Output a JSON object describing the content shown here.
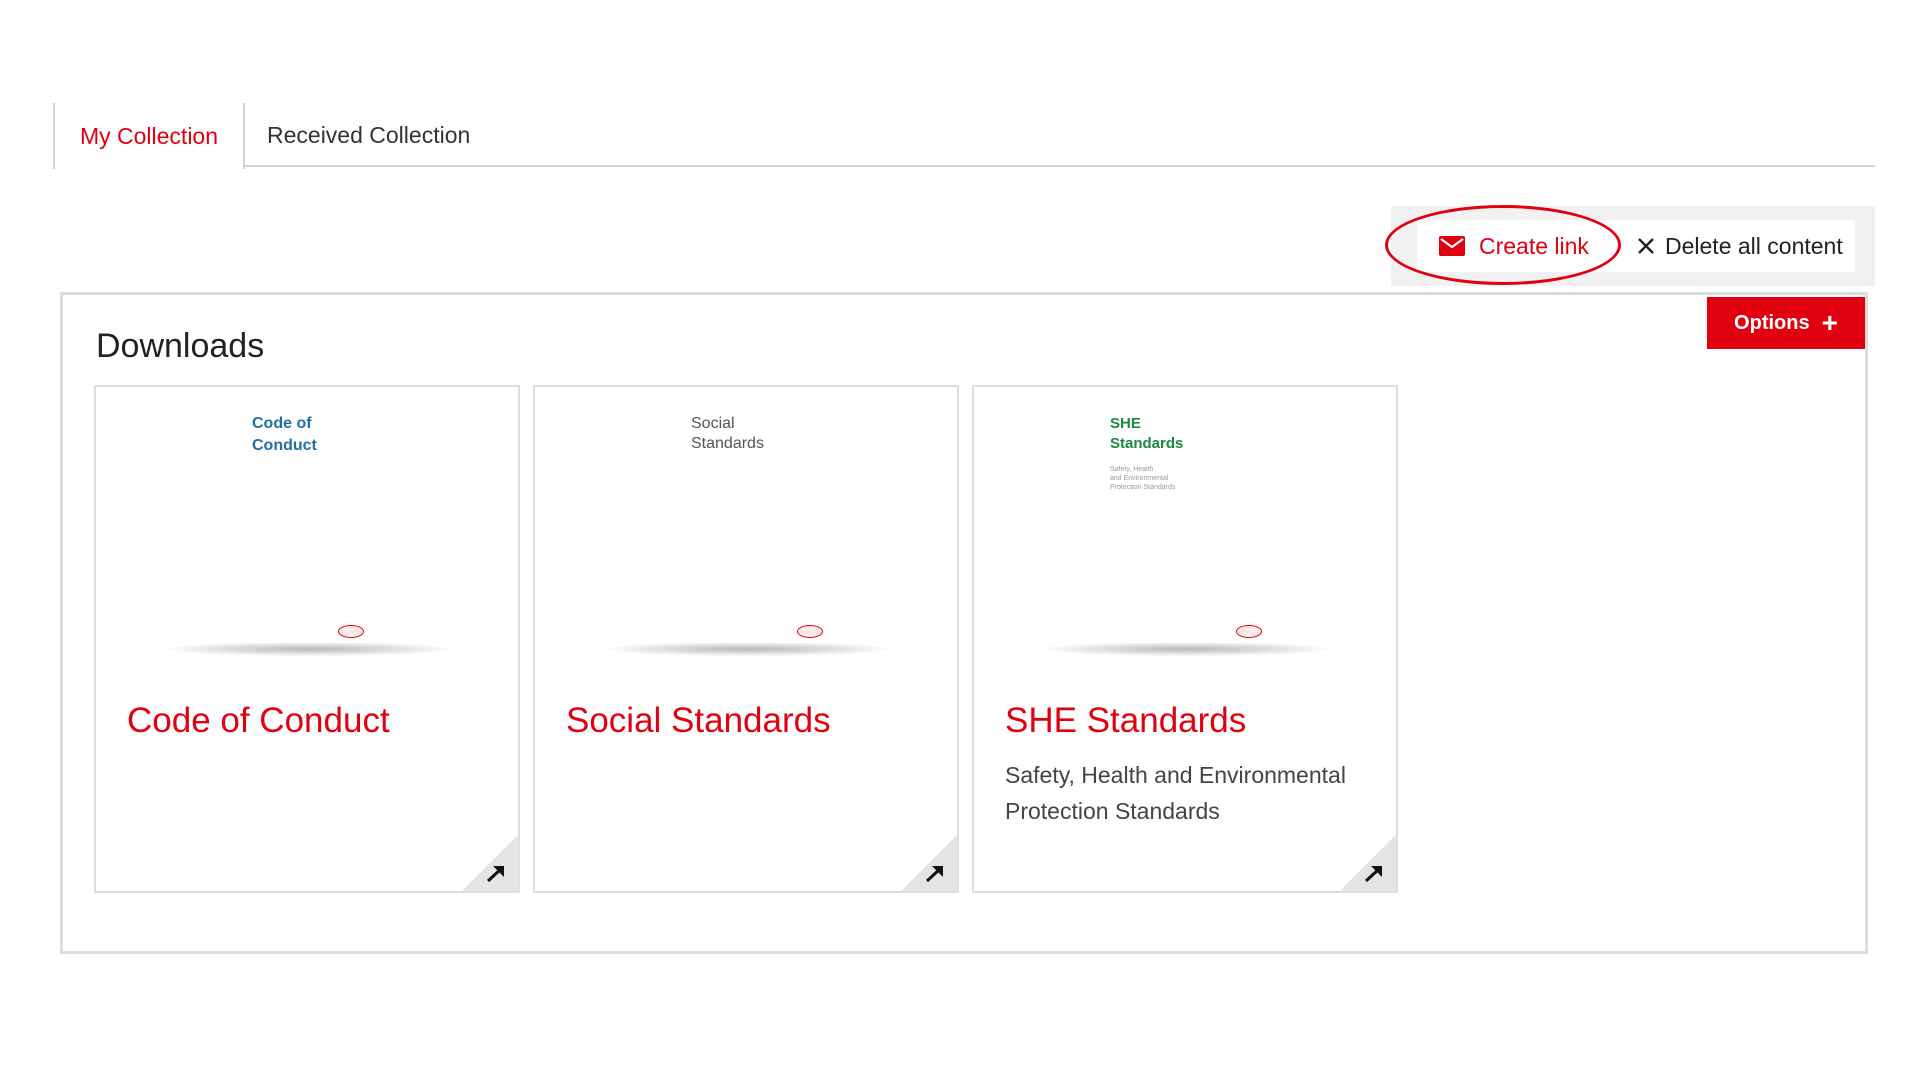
{
  "tabs": [
    {
      "label": "My Collection",
      "active": true
    },
    {
      "label": "Received Collection",
      "active": false
    }
  ],
  "actions": {
    "create_link": "Create link",
    "delete_all": "Delete all content"
  },
  "downloads": {
    "title": "Downloads",
    "options_label": "Options",
    "items": [
      {
        "cover_title": [
          "Code of",
          "Conduct"
        ],
        "title": "Code of Conduct",
        "description": ""
      },
      {
        "cover_title": [
          "Social",
          "Standards"
        ],
        "title": "Social Standards",
        "description": ""
      },
      {
        "cover_title": [
          "SHE",
          "Standards"
        ],
        "cover_subtitle": [
          "Safety, Health",
          "and Environmental",
          "Protection Standards"
        ],
        "title": "SHE Standards",
        "description": "Safety, Health and Environmental Protection Standards"
      }
    ]
  },
  "colors": {
    "accent": "#e1000f",
    "cover_title_code": "#1f6fa5",
    "cover_title_social": "#555555",
    "cover_title_she": "#1a8a3e"
  },
  "icons": [
    "mail-icon",
    "close-icon",
    "plus-icon",
    "henkel-logo",
    "arrow-up-right-icon"
  ]
}
